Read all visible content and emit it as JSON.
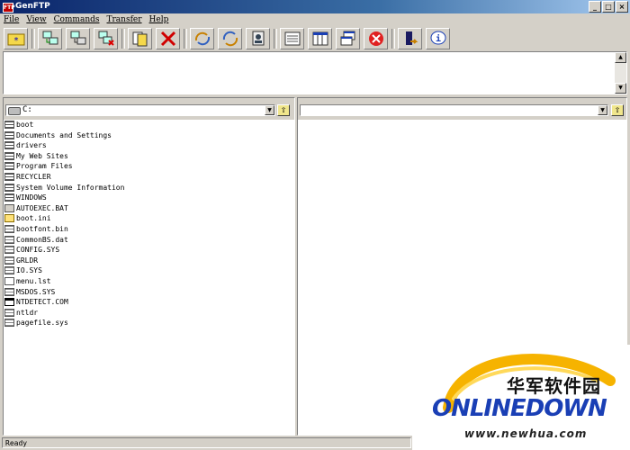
{
  "window": {
    "title": "GenFTP",
    "icon_label": "FTP"
  },
  "menu": [
    "File",
    "View",
    "Commands",
    "Transfer",
    "Help"
  ],
  "toolbar": [
    "new-session-icon",
    "connect-icon",
    "disconnect-icon",
    "delete-connection-icon",
    "copy-icon",
    "delete-icon",
    "refresh-icon",
    "sync-icon",
    "properties-icon",
    "log-icon",
    "view-icon",
    "window-icon",
    "stop-icon",
    "exit-icon",
    "help-icon"
  ],
  "local": {
    "path": "C:",
    "files": [
      {
        "name": "boot",
        "type": "folder"
      },
      {
        "name": "Documents and Settings",
        "type": "folder"
      },
      {
        "name": "drivers",
        "type": "folder"
      },
      {
        "name": "My Web Sites",
        "type": "folder"
      },
      {
        "name": "Program Files",
        "type": "folder"
      },
      {
        "name": "RECYCLER",
        "type": "folder"
      },
      {
        "name": "System Volume Information",
        "type": "folder"
      },
      {
        "name": "WINDOWS",
        "type": "folder"
      },
      {
        "name": "AUTOEXEC.BAT",
        "type": "bat"
      },
      {
        "name": "boot.ini",
        "type": "ini"
      },
      {
        "name": "bootfont.bin",
        "type": "file"
      },
      {
        "name": "CommonBS.dat",
        "type": "file"
      },
      {
        "name": "CONFIG.SYS",
        "type": "file"
      },
      {
        "name": "GRLDR",
        "type": "file"
      },
      {
        "name": "IO.SYS",
        "type": "file"
      },
      {
        "name": "menu.lst",
        "type": "txt"
      },
      {
        "name": "MSDOS.SYS",
        "type": "file"
      },
      {
        "name": "NTDETECT.COM",
        "type": "com"
      },
      {
        "name": "ntldr",
        "type": "file"
      },
      {
        "name": "pagefile.sys",
        "type": "file"
      }
    ]
  },
  "remote": {
    "path": ""
  },
  "status": {
    "text": "Ready"
  },
  "watermark": {
    "cn": "华军软件园",
    "en": "ONLINEDOWN",
    "url": "www.newhua.com"
  },
  "colors": {
    "titlebar": "#0a246a",
    "face": "#d4d0c8",
    "stop": "#e02020"
  }
}
